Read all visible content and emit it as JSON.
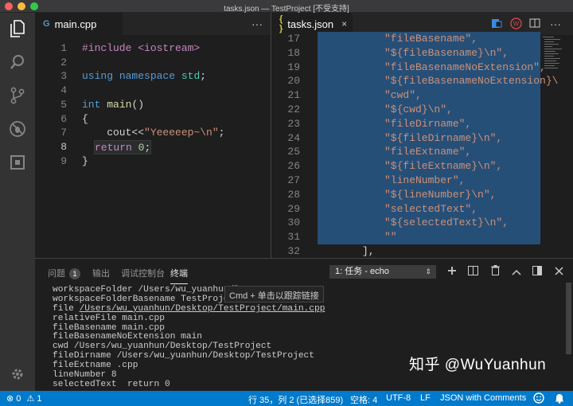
{
  "window": {
    "title": "tasks.json — TestProject [不受支持]"
  },
  "activity": {
    "icons": [
      "files-icon",
      "search-icon",
      "source-control-icon",
      "debug-icon",
      "extensions-icon",
      "gear-icon"
    ]
  },
  "left_editor": {
    "tab": {
      "icon": "G",
      "label": "main.cpp"
    },
    "line_numbers": [
      "1",
      "2",
      "3",
      "4",
      "5",
      "6",
      "7",
      "8",
      "9"
    ],
    "lines": [
      [
        {
          "t": "#include <iostream>",
          "c": "pp"
        }
      ],
      [],
      [
        {
          "t": "using",
          "c": "kw"
        },
        {
          "t": " ",
          "c": "plain"
        },
        {
          "t": "namespace",
          "c": "kw"
        },
        {
          "t": " ",
          "c": "plain"
        },
        {
          "t": "std",
          "c": "ns"
        },
        {
          "t": ";",
          "c": "plain"
        }
      ],
      [],
      [
        {
          "t": "int",
          "c": "kw"
        },
        {
          "t": " ",
          "c": "plain"
        },
        {
          "t": "main",
          "c": "fn"
        },
        {
          "t": "()",
          "c": "plain"
        }
      ],
      [
        {
          "t": "{",
          "c": "plain"
        }
      ],
      [
        {
          "t": "    cout<<",
          "c": "plain"
        },
        {
          "t": "\"Yeeeeep~\\n\"",
          "c": "str"
        },
        {
          "t": ";",
          "c": "plain"
        }
      ],
      [
        {
          "t": "    ",
          "c": "plain"
        },
        {
          "t": "return",
          "c": "pp"
        },
        {
          "t": " ",
          "c": "plain"
        },
        {
          "t": "0",
          "c": "num"
        },
        {
          "t": ";",
          "c": "plain"
        }
      ],
      [
        {
          "t": "}",
          "c": "plain"
        }
      ]
    ],
    "current_line": 8,
    "more": "···"
  },
  "right_editor": {
    "tab": {
      "icon": "{ }",
      "label": "tasks.json",
      "close": "×"
    },
    "line_numbers": [
      "17",
      "18",
      "19",
      "20",
      "21",
      "22",
      "23",
      "24",
      "25",
      "26",
      "27",
      "28",
      "29",
      "30",
      "31",
      "32"
    ],
    "lines": [
      "\"fileBasename\",",
      "\"${fileBasename}\\n\",",
      "\"fileBasenameNoExtension\",",
      "\"${fileBasenameNoExtension}\\",
      "\"cwd\",",
      "\"${cwd}\\n\",",
      "\"fileDirname\",",
      "\"${fileDirname}\\n\",",
      "\"fileExtname\",",
      "\"${fileExtname}\\n\",",
      "\"lineNumber\",",
      "\"${lineNumber}\\n\",",
      "\"selectedText\",",
      "\"${selectedText}\\n\",",
      "\"\"",
      "],"
    ],
    "more": "···"
  },
  "panel": {
    "tabs": [
      "问题",
      "输出",
      "调试控制台",
      "终端"
    ],
    "problems_count": "1",
    "terminal_select": "1: 任务 - echo",
    "terminal_lines": [
      "workspaceFolder /Users/wu_yuanhun/De",
      "workspaceFolderBasename TestProject",
      "file /Users/wu_yuanhun/Desktop/TestProject/main.cpp",
      "relativeFile main.cpp",
      "fileBasename main.cpp",
      "fileBasenameNoExtension main",
      "cwd /Users/wu_yuanhun/Desktop/TestProject",
      "fileDirname /Users/wu_yuanhun/Desktop/TestProject",
      "fileExtname .cpp",
      "lineNumber 8",
      "selectedText  return 0"
    ],
    "tooltip": "Cmd + 单击以跟踪链接",
    "watermark": "知乎 @WuYuanhun"
  },
  "status": {
    "errors": "0",
    "warnings": "1",
    "position": "行 35，列 2 (已选择859)",
    "spaces": "空格: 4",
    "encoding": "UTF-8",
    "eol": "LF",
    "language": "JSON with Comments"
  }
}
